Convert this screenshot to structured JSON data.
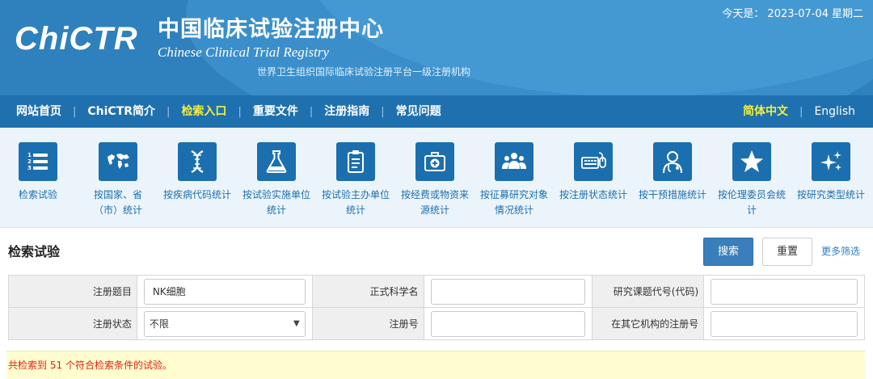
{
  "header": {
    "logo_text": "ChiCTR",
    "title_cn": "中国临床试验注册中心",
    "title_en": "Chinese Clinical Trial Registry",
    "subtitle": "世界卫生组织国际临床试验注册平台一级注册机构",
    "date_label": "今天是：",
    "date_value": "2023-07-04",
    "weekday": "星期二",
    "bg_color": "#2f81bd"
  },
  "nav": {
    "items": [
      {
        "label": "网站首页",
        "active": false
      },
      {
        "label": "ChiCTR简介",
        "active": false
      },
      {
        "label": "检索入口",
        "active": true
      },
      {
        "label": "重要文件",
        "active": false
      },
      {
        "label": "注册指南",
        "active": false
      },
      {
        "label": "常见问题",
        "active": false
      }
    ],
    "lang_current": "简体中文",
    "lang_other": "English",
    "active_color": "#f3ef3f"
  },
  "icon_bar": {
    "items": [
      {
        "label": "检索试验",
        "icon": "list-numbered-icon"
      },
      {
        "label": "按国家、省（市）统计",
        "icon": "world-map-icon"
      },
      {
        "label": "按疾病代码统计",
        "icon": "dna-icon"
      },
      {
        "label": "按试验实施单位统计",
        "icon": "flask-icon"
      },
      {
        "label": "按试验主办单位统计",
        "icon": "clipboard-icon"
      },
      {
        "label": "按经费或物资来源统计",
        "icon": "medical-kit-icon"
      },
      {
        "label": "按征募研究对象情况统计",
        "icon": "people-icon"
      },
      {
        "label": "按注册状态统计",
        "icon": "keyboard-mouse-icon"
      },
      {
        "label": "按干预措施统计",
        "icon": "doctor-icon"
      },
      {
        "label": "按伦理委员会统计",
        "icon": "star-icon"
      },
      {
        "label": "按研究类型统计",
        "icon": "sparkle-icon"
      }
    ]
  },
  "search": {
    "title": "检索试验",
    "search_button": "搜索",
    "reset_button": "重置",
    "more_filters": "更多筛选",
    "fields": {
      "reg_title_label": "注册题目",
      "reg_title_value": "NK细胞",
      "sci_name_label": "正式科学名",
      "sci_name_value": "",
      "project_code_label": "研究课题代号(代码)",
      "project_code_value": "",
      "reg_status_label": "注册状态",
      "reg_status_value": "不限",
      "reg_number_label": "注册号",
      "reg_number_value": "",
      "other_reg_label": "在其它机构的注册号",
      "other_reg_value": ""
    }
  },
  "result": {
    "prefix": "共检索到",
    "count": "51",
    "suffix": "个符合检索条件的试验。",
    "color": "#e0220f"
  }
}
